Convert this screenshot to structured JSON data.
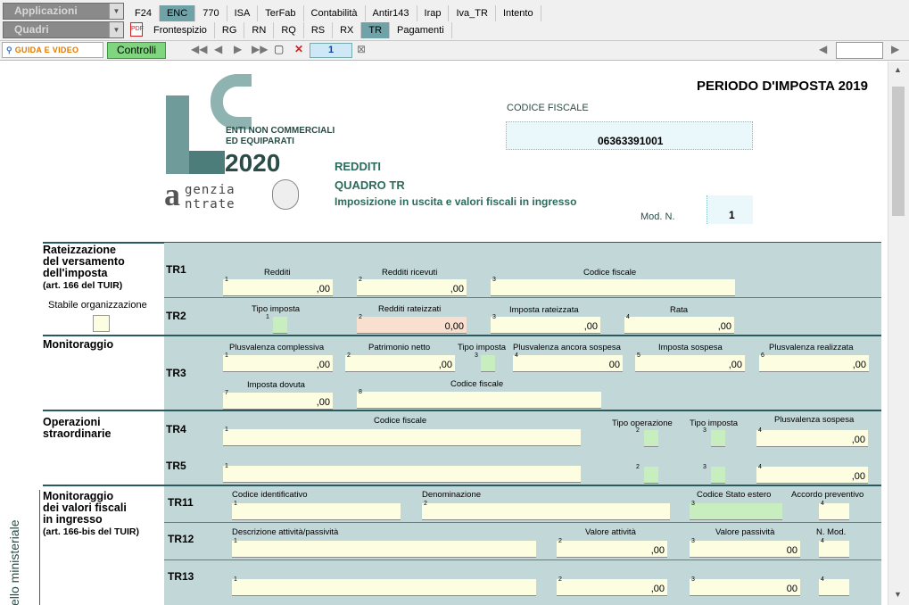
{
  "menu": {
    "applicazioni": "Applicazioni",
    "quadri": "Quadri",
    "tabs_top": [
      "F24",
      "ENC",
      "770",
      "ISA",
      "TerFab",
      "Contabilità",
      "Antir143",
      "Irap",
      "Iva_TR",
      "Intento"
    ],
    "tabs_bottom": [
      "Frontespizio",
      "RG",
      "RN",
      "RQ",
      "RS",
      "RX",
      "TR",
      "Pagamenti"
    ]
  },
  "toolbar": {
    "guida": "GUIDA E VIDEO",
    "controlli": "Controlli",
    "page": "1"
  },
  "header": {
    "periodo": "PERIODO D'IMPOSTA 2019",
    "codice_fiscale_label": "CODICE FISCALE",
    "codice_fiscale": "06363391001",
    "logo_line1": "ENTI NON COMMERCIALI",
    "logo_line2": "ED EQUIPARATI",
    "logo_year": "2020",
    "agenzia": "genzia",
    "entrate": "ntrate",
    "redditi": "REDDITI",
    "quadro": "QUADRO TR",
    "subtitle": "Imposizione in uscita e valori fiscali in ingresso",
    "mod_label": "Mod. N.",
    "mod_value": "1"
  },
  "left": {
    "sec1": [
      "Rateizzazione",
      "del versamento",
      "dell'imposta"
    ],
    "sec1_note": "(art. 166 del TUIR)",
    "stabile": "Stabile organizzazione",
    "sec2": "Monitoraggio",
    "sec3": [
      "Operazioni",
      "straordinarie"
    ],
    "sec4": [
      "Monitoraggio",
      "dei valori fiscali",
      "in ingresso"
    ],
    "sec4_note": "(art. 166-bis del TUIR)",
    "vertical": "ello ministeriale"
  },
  "rows": {
    "tr1": {
      "code": "TR1",
      "redditi": "Redditi",
      "redditi_ricevuti": "Redditi ricevuti",
      "codice_fiscale": "Codice fiscale",
      "v1": ",00",
      "v2": ",00"
    },
    "tr2": {
      "code": "TR2",
      "tipo_imposta": "Tipo imposta",
      "redditi_rateizzati": "Redditi rateizzati",
      "imposta_rateizzata": "Imposta rateizzata",
      "rata": "Rata",
      "v2": "0,00",
      "v3": ",00",
      "v4": ",00"
    },
    "tr3": {
      "code": "TR3",
      "plus_compl": "Plusvalenza complessiva",
      "patrimonio": "Patrimonio netto",
      "tipo_imposta": "Tipo imposta",
      "plus_sospesa": "Plusvalenza ancora sospesa",
      "imposta_sospesa": "Imposta sospesa",
      "plus_realizzata": "Plusvalenza realizzata",
      "imposta_dovuta": "Imposta dovuta",
      "codice_fiscale": "Codice fiscale",
      "v1": ",00",
      "v2": ",00",
      "v4": "00",
      "v5": ",00",
      "v6": ",00",
      "v7": ",00"
    },
    "tr4": {
      "code": "TR4",
      "codice_fiscale": "Codice fiscale",
      "tipo_operazione": "Tipo operazione",
      "tipo_imposta": "Tipo imposta",
      "plus_sospesa": "Plusvalenza sospesa",
      "v4": ",00"
    },
    "tr5": {
      "code": "TR5",
      "v4": ",00"
    },
    "tr11": {
      "code": "TR11",
      "cod_id": "Codice identificativo",
      "denominazione": "Denominazione",
      "cod_stato": "Codice Stato estero",
      "accordo": "Accordo preventivo"
    },
    "tr12": {
      "code": "TR12",
      "descr": "Descrizione attività/passività",
      "val_att": "Valore attività",
      "val_pass": "Valore passività",
      "nmod": "N. Mod.",
      "v2": ",00",
      "v3": "00"
    },
    "tr13": {
      "code": "TR13",
      "v2": ",00",
      "v3": "00"
    }
  },
  "colors": {
    "teal": "#c2d7d8",
    "field": "#fdfde2",
    "green": "#c8eec0",
    "pink": "#f9dfcf",
    "title": "#2b6b5b"
  }
}
